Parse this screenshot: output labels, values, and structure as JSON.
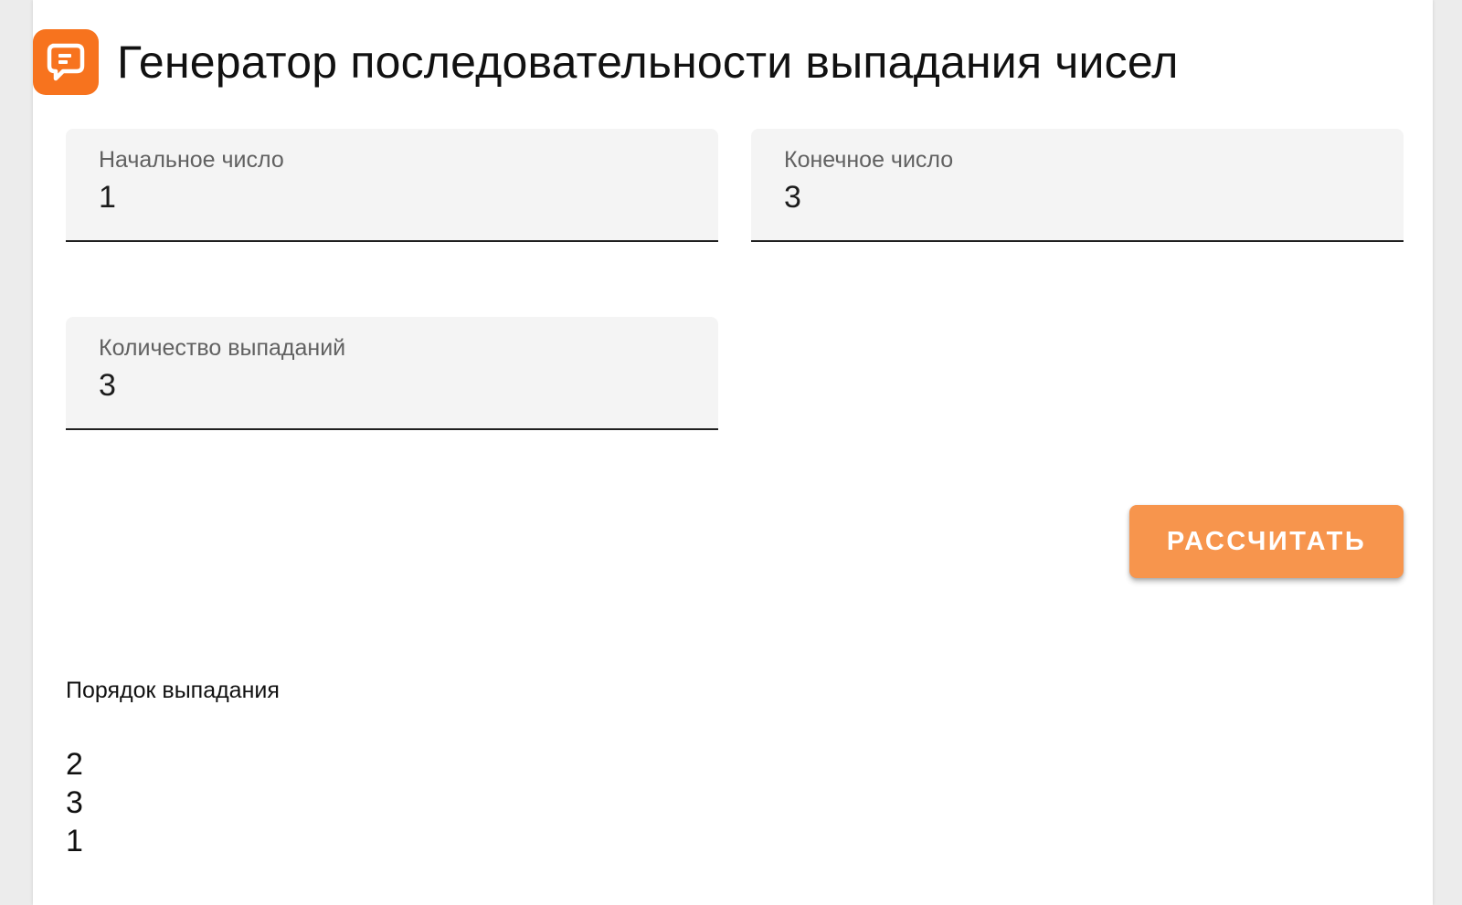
{
  "app": {
    "title": "Генератор последовательности выпадания чисел",
    "logo_icon": "chat-bubble-p-icon",
    "accent_color": "#f7731e"
  },
  "form": {
    "start": {
      "label": "Начальное число",
      "value": "1"
    },
    "end": {
      "label": "Конечное число",
      "value": "3"
    },
    "count": {
      "label": "Количество выпаданий",
      "value": "3"
    },
    "calculate_label": "РАССЧИТАТЬ",
    "button_color": "#f7954d"
  },
  "result": {
    "label": "Порядок выпадания",
    "items": [
      "2",
      "3",
      "1"
    ]
  }
}
